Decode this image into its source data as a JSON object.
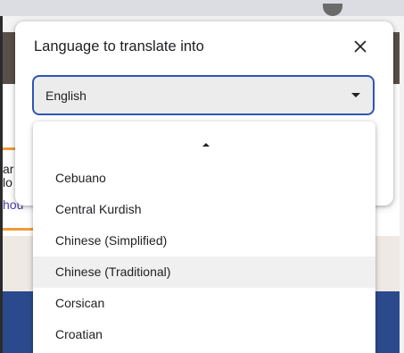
{
  "background": {
    "fragment_line_1": "ar",
    "fragment_line_2": "lo",
    "fragment_link": "hou"
  },
  "dialog": {
    "title": "Language to translate into",
    "close_icon": "close-icon",
    "select": {
      "value": "English",
      "caret_icon": "caret-down-icon"
    }
  },
  "dropdown": {
    "scroll_icon": "caret-up-icon",
    "options": [
      {
        "label": "Cebuano",
        "highlighted": false
      },
      {
        "label": "Central Kurdish",
        "highlighted": false
      },
      {
        "label": "Chinese (Simplified)",
        "highlighted": false
      },
      {
        "label": "Chinese (Traditional)",
        "highlighted": true
      },
      {
        "label": "Corsican",
        "highlighted": false
      },
      {
        "label": "Croatian",
        "highlighted": false
      }
    ]
  },
  "colors": {
    "focus_border": "#2f55b4",
    "highlight_row": "#f0f0f0",
    "link_text": "#4a3aa8"
  }
}
